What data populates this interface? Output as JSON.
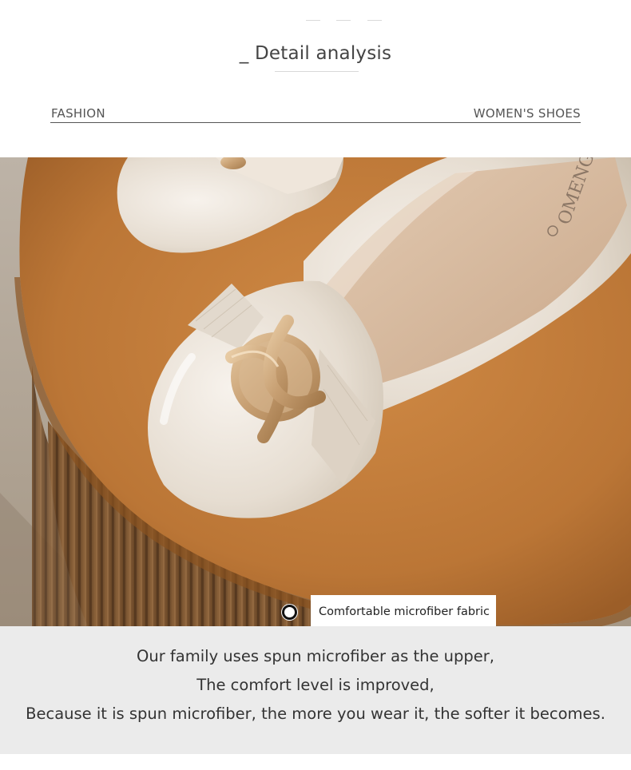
{
  "header": {
    "title": "_ Detail analysis",
    "left_tag": "FASHION",
    "right_tag": "WOMEN'S SHOES"
  },
  "photo": {
    "description_icon": "shoe-product-photo",
    "brand_print": "OMENGSI",
    "callout_label": "Comfortable microfiber fabric"
  },
  "footer": {
    "lines": [
      "Our family uses spun microfiber as the upper,",
      "The comfort level is improved,",
      "Because it is spun microfiber, the more you wear it, the softer it becomes."
    ]
  },
  "colors": {
    "stool": "#c07a3a",
    "shoe": "#e8e0d6",
    "buckle": "#c9a57c",
    "footer_bg": "#ebebeb"
  }
}
